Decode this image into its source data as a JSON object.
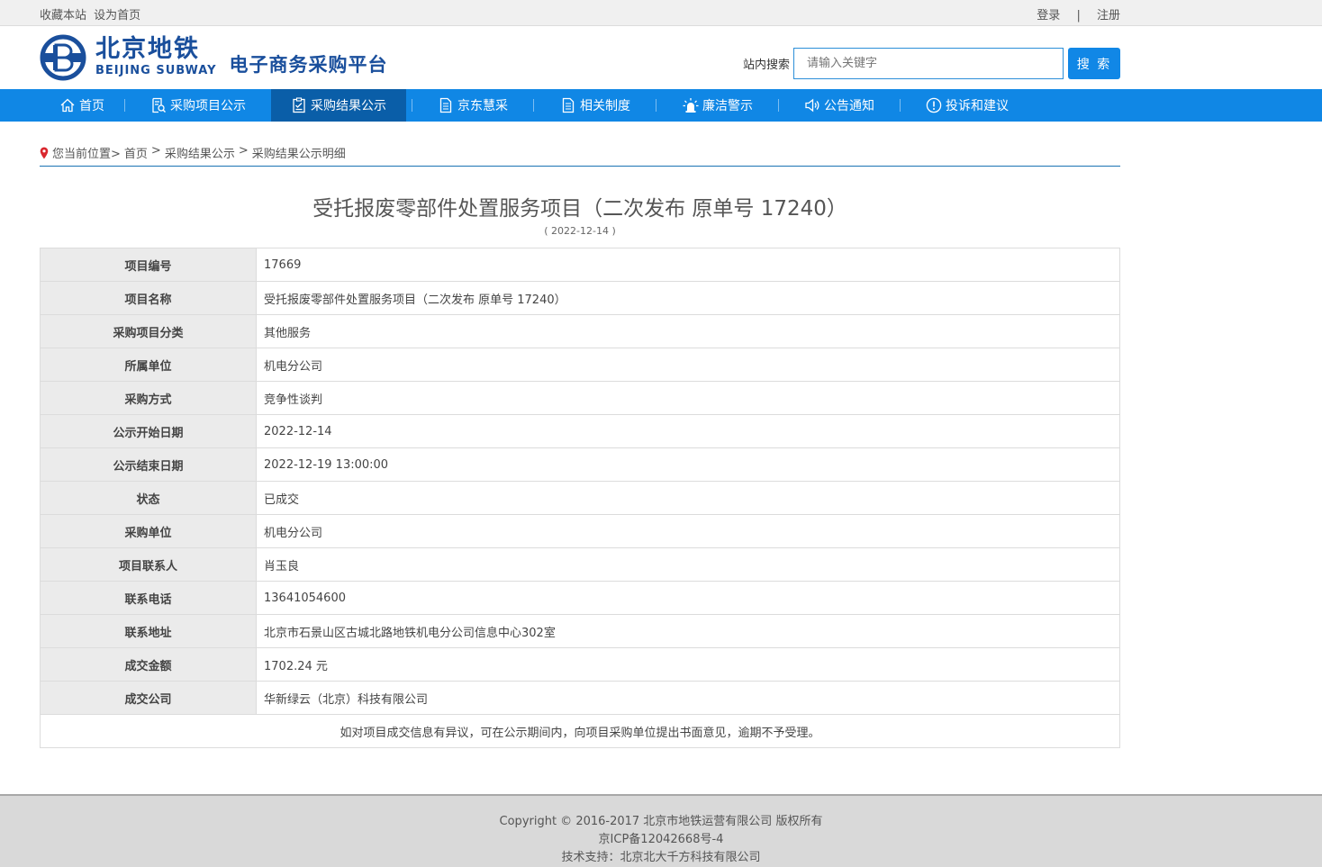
{
  "topbar": {
    "favorite": "收藏本站",
    "homepage": "设为首页",
    "login": "登录",
    "separator": "|",
    "register": "注册"
  },
  "brand": {
    "name_cn": "北京地铁",
    "name_en": "BEIJING SUBWAY",
    "platform": "电子商务采购平台",
    "color": "#1a4f9c"
  },
  "search": {
    "label": "站内搜索",
    "placeholder": "请输入关键字",
    "button": "搜 索"
  },
  "nav": {
    "color": "#1087e5",
    "active_color": "#0a5ea8",
    "items": [
      {
        "label": "首页",
        "icon": "home-icon"
      },
      {
        "label": "采购项目公示",
        "icon": "document-search-icon"
      },
      {
        "label": "采购结果公示",
        "icon": "checklist-icon"
      },
      {
        "label": "京东慧采",
        "icon": "document-icon"
      },
      {
        "label": "相关制度",
        "icon": "document-icon"
      },
      {
        "label": "廉洁警示",
        "icon": "alarm-light-icon"
      },
      {
        "label": "公告通知",
        "icon": "speaker-icon"
      },
      {
        "label": "投诉和建议",
        "icon": "exclamation-circle-icon"
      }
    ],
    "active_index": 2
  },
  "breadcrumb": {
    "prefix": "您当前位置>",
    "home": "首页",
    "sep1": ">",
    "section": "采购结果公示",
    "sep2": ">",
    "current": "采购结果公示明细"
  },
  "article": {
    "title": "受托报废零部件处置服务项目（二次发布 原单号 17240）",
    "date": "( 2022-12-14 )"
  },
  "details": {
    "rows": [
      {
        "key": "项目编号",
        "value": "17669"
      },
      {
        "key": "项目名称",
        "value": "受托报废零部件处置服务项目（二次发布 原单号 17240）"
      },
      {
        "key": "采购项目分类",
        "value": "其他服务"
      },
      {
        "key": "所属单位",
        "value": "机电分公司"
      },
      {
        "key": "采购方式",
        "value": "竞争性谈判"
      },
      {
        "key": "公示开始日期",
        "value": "2022-12-14"
      },
      {
        "key": "公示结束日期",
        "value": "2022-12-19 13:00:00"
      },
      {
        "key": "状态",
        "value": "已成交"
      },
      {
        "key": "采购单位",
        "value": "机电分公司"
      },
      {
        "key": "项目联系人",
        "value": "肖玉良"
      },
      {
        "key": "联系电话",
        "value": "13641054600"
      },
      {
        "key": "联系地址",
        "value": "北京市石景山区古城北路地铁机电分公司信息中心302室"
      },
      {
        "key": "成交金额",
        "value": "1702.24 元"
      },
      {
        "key": "成交公司",
        "value": "华新绿云（北京）科技有限公司"
      }
    ],
    "note": "如对项目成交信息有异议，可在公示期间内，向项目采购单位提出书面意见，逾期不予受理。"
  },
  "footer": {
    "copyright": "Copyright © 2016-2017 北京市地铁运营有限公司 版权所有",
    "icp": "京ICP备12042668号-4",
    "support": "技术支持：北京北大千方科技有限公司"
  }
}
